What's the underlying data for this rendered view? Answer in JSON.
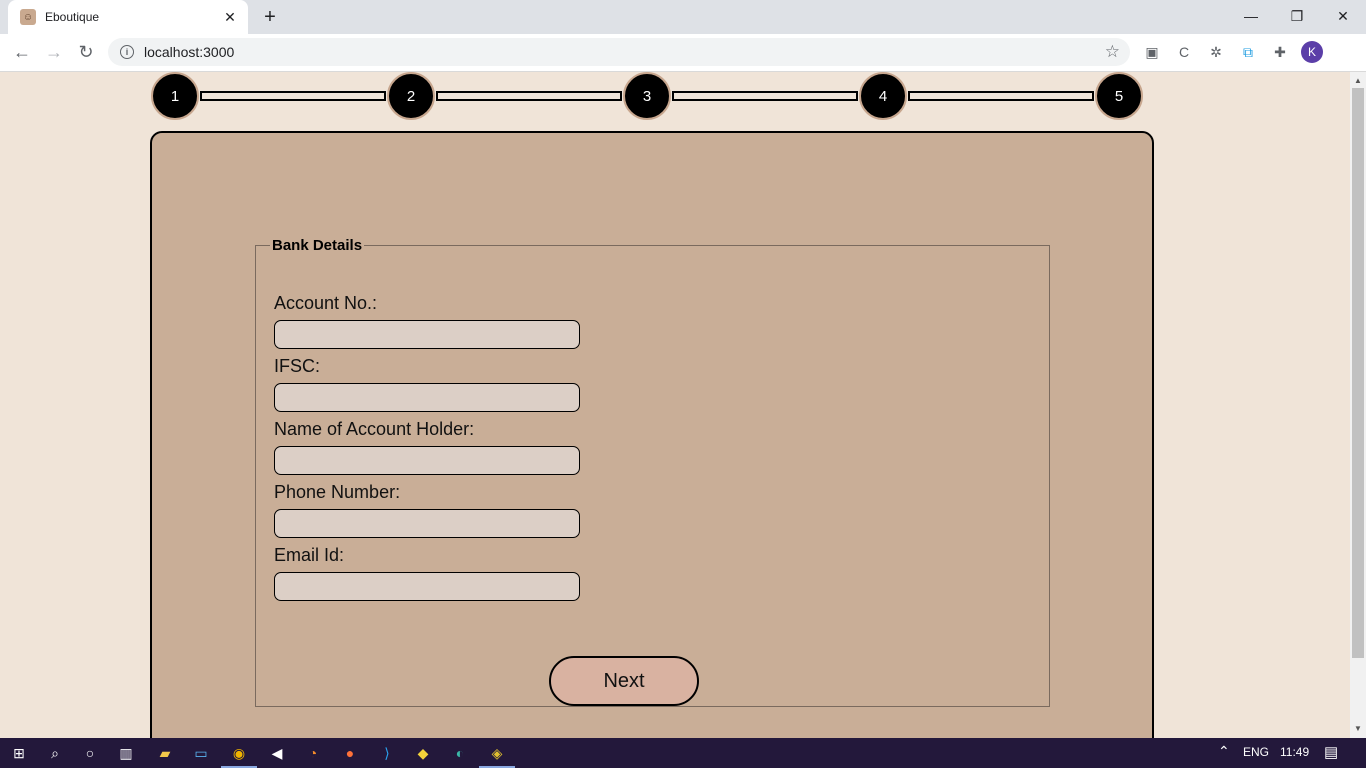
{
  "browser": {
    "tab_title": "Eboutique",
    "favicon_icon": "boutique-icon",
    "url": "localhost:3000",
    "profile_initial": "K"
  },
  "stepper": {
    "steps": [
      "1",
      "2",
      "3",
      "4",
      "5"
    ]
  },
  "form": {
    "legend": "Bank Details",
    "fields": [
      {
        "label": "Account No.:",
        "value": ""
      },
      {
        "label": "IFSC:",
        "value": ""
      },
      {
        "label": "Name of Account Holder:",
        "value": ""
      },
      {
        "label": "Phone Number:",
        "value": ""
      },
      {
        "label": "Email Id:",
        "value": ""
      }
    ],
    "next_label": "Next"
  },
  "taskbar": {
    "language": "ENG",
    "time": "11:49"
  },
  "colors": {
    "page_bg": "#f0e4d8",
    "card_bg": "#c9ae97",
    "input_bg": "#dccfc6",
    "button_bg": "#d9b2a1"
  }
}
